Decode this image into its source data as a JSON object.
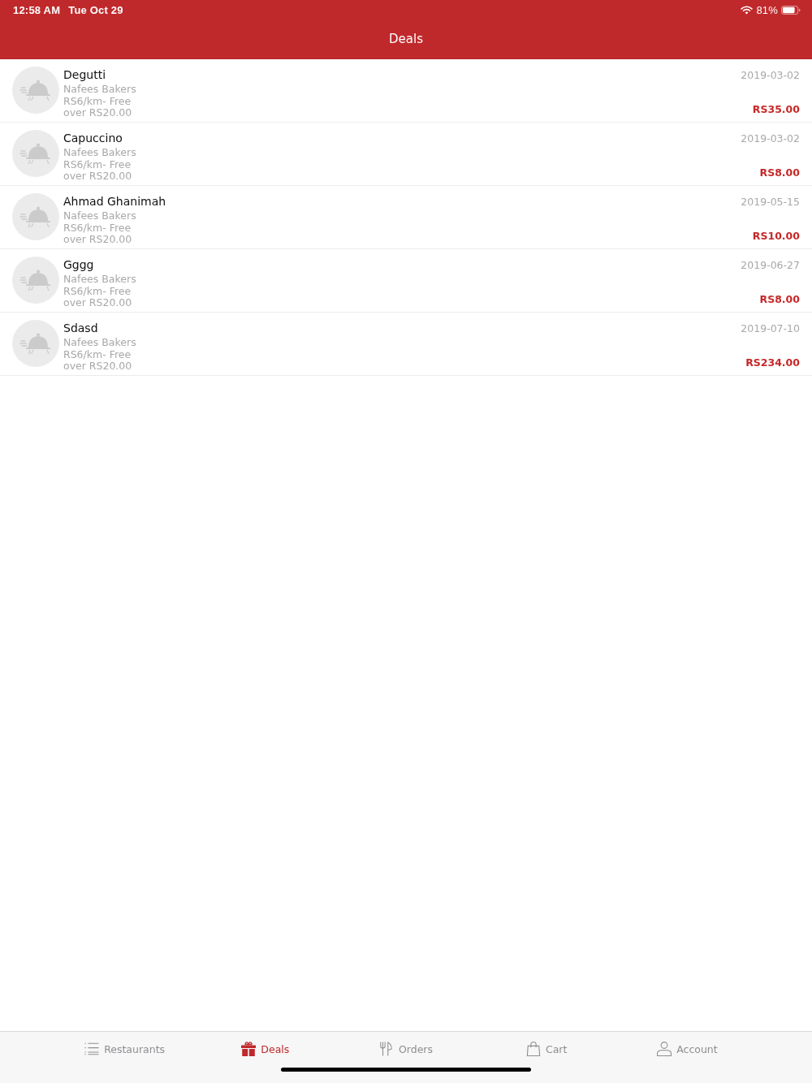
{
  "status_bar": {
    "time": "12:58 AM",
    "date": "Tue Oct 29",
    "battery": "81%"
  },
  "nav_bar": {
    "title": "Deals"
  },
  "deals": [
    {
      "title": "Degutti",
      "restaurant": "Nafees Bakers",
      "delivery": "RS6/km- Free over RS20.00",
      "date": "2019-03-02",
      "price": "RS35.00"
    },
    {
      "title": "Capuccino",
      "restaurant": "Nafees Bakers",
      "delivery": "RS6/km- Free over RS20.00",
      "date": "2019-03-02",
      "price": "RS8.00"
    },
    {
      "title": "Ahmad Ghanimah",
      "restaurant": "Nafees Bakers",
      "delivery": "RS6/km- Free over RS20.00",
      "date": "2019-05-15",
      "price": "RS10.00"
    },
    {
      "title": "Gggg",
      "restaurant": "Nafees Bakers",
      "delivery": "RS6/km- Free over RS20.00",
      "date": "2019-06-27",
      "price": "RS8.00"
    },
    {
      "title": "Sdasd",
      "restaurant": "Nafees Bakers",
      "delivery": "RS6/km- Free over RS20.00",
      "date": "2019-07-10",
      "price": "RS234.00"
    }
  ],
  "tab_bar": [
    {
      "label": "Restaurants",
      "kind": "list",
      "selected": false
    },
    {
      "label": "Deals",
      "kind": "gift",
      "selected": true
    },
    {
      "label": "Orders",
      "kind": "utensils",
      "selected": false
    },
    {
      "label": "Cart",
      "kind": "bag",
      "selected": false
    },
    {
      "label": "Account",
      "kind": "person",
      "selected": false
    }
  ]
}
